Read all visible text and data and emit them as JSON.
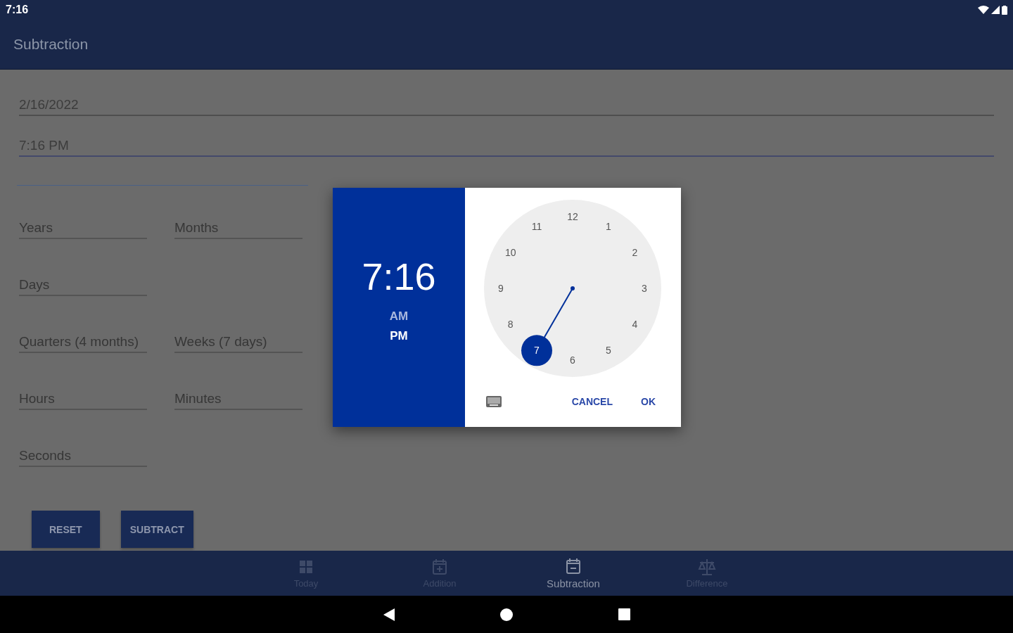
{
  "status_bar": {
    "time": "7:16"
  },
  "app_bar": {
    "title": "Subtraction"
  },
  "date_field": {
    "value": "2/16/2022"
  },
  "time_field": {
    "value": "7:16 PM",
    "focused": true
  },
  "extra_field": {
    "focused": true
  },
  "duration_rows": [
    [
      {
        "placeholder": "Years"
      },
      {
        "placeholder": "Months"
      }
    ],
    [
      {
        "placeholder": "Days"
      }
    ],
    [
      {
        "placeholder": "Quarters (4 months)"
      },
      {
        "placeholder": "Weeks (7 days)"
      }
    ],
    [
      {
        "placeholder": "Hours"
      },
      {
        "placeholder": "Minutes"
      }
    ],
    [
      {
        "placeholder": "Seconds"
      }
    ]
  ],
  "buttons": [
    "RESET",
    "SUBTRACT"
  ],
  "time_dialog": {
    "time": "7:16",
    "periods": [
      {
        "label": "AM",
        "selected": false
      },
      {
        "label": "PM",
        "selected": true
      }
    ],
    "dial": [
      {
        "label": "12",
        "selected": false
      },
      {
        "label": "1",
        "selected": false
      },
      {
        "label": "2",
        "selected": false
      },
      {
        "label": "3",
        "selected": false
      },
      {
        "label": "4",
        "selected": false
      },
      {
        "label": "5",
        "selected": false
      },
      {
        "label": "6",
        "selected": false
      },
      {
        "label": "7",
        "selected": true
      },
      {
        "label": "8",
        "selected": false
      },
      {
        "label": "9",
        "selected": false
      },
      {
        "label": "10",
        "selected": false
      },
      {
        "label": "11",
        "selected": false
      }
    ],
    "actions": [
      "CANCEL",
      "OK"
    ]
  },
  "bottom_nav": [
    {
      "kind": "grid",
      "label": "Today",
      "selected": false
    },
    {
      "kind": "add",
      "label": "Addition",
      "selected": false
    },
    {
      "kind": "minus",
      "label": "Subtraction",
      "selected": true
    },
    {
      "kind": "scale",
      "label": "Difference",
      "selected": false
    }
  ]
}
